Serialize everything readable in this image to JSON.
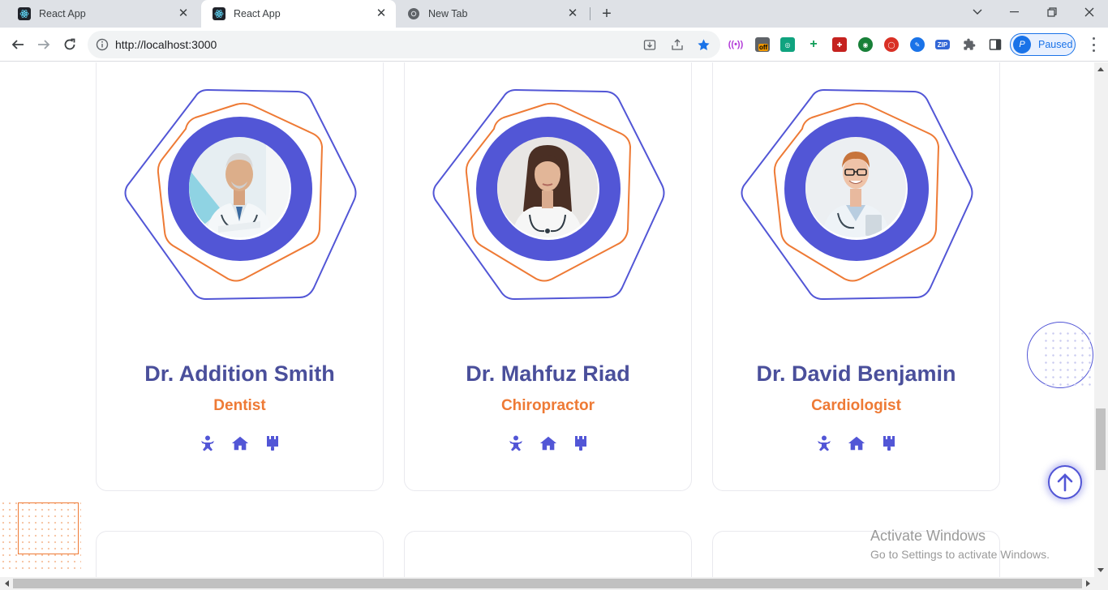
{
  "browser": {
    "tabs": [
      {
        "label": "React App",
        "active": false
      },
      {
        "label": "React App",
        "active": true
      },
      {
        "label": "New Tab",
        "active": false
      }
    ],
    "url": "http://localhost:3000",
    "profile_label": "Paused",
    "profile_initial": "P",
    "ext_badge_off": "off",
    "ext_zip": "ZIP"
  },
  "doctors": [
    {
      "name": "Dr. Addition Smith",
      "specialty": "Dentist"
    },
    {
      "name": "Dr. Mahfuz Riad",
      "specialty": "Chiropractor"
    },
    {
      "name": "Dr. David Benjamin",
      "specialty": "Cardiologist"
    }
  ],
  "social_icons": [
    "baby-icon",
    "home-icon",
    "paint-brush-icon"
  ],
  "windows_notice": {
    "title": "Activate Windows",
    "subtitle": "Go to Settings to activate Windows."
  },
  "colors": {
    "primary": "#5256d6",
    "heading": "#4a4f9b",
    "accent": "#ee7a35"
  }
}
